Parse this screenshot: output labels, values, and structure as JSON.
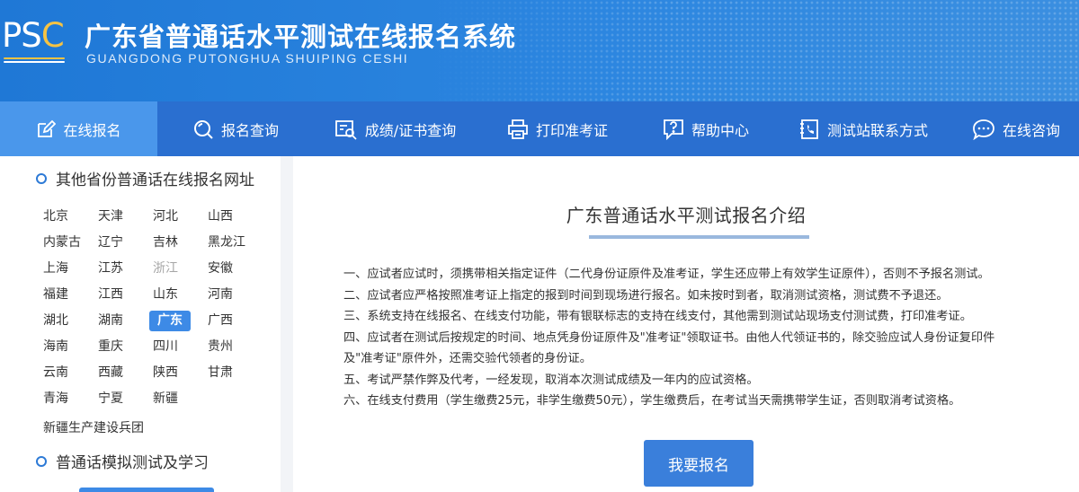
{
  "header": {
    "logo": "PSC",
    "title": "广东省普通话水平测试在线报名系统",
    "subtitle": "GUANGDONG PUTONGHUA SHUIPING CESHI"
  },
  "nav": {
    "items": [
      {
        "label": "在线报名",
        "icon": "edit-icon",
        "active": true
      },
      {
        "label": "报名查询",
        "icon": "search-icon"
      },
      {
        "label": "成绩/证书查询",
        "icon": "certificate-search-icon"
      },
      {
        "label": "打印准考证",
        "icon": "printer-icon"
      },
      {
        "label": "帮助中心",
        "icon": "help-icon"
      },
      {
        "label": "测试站联系方式",
        "icon": "phone-book-icon"
      },
      {
        "label": "在线咨询",
        "icon": "chat-icon"
      }
    ]
  },
  "sidebar": {
    "heading_provinces": "其他省份普通话在线报名网址",
    "provinces": [
      "北京",
      "天津",
      "河北",
      "山西",
      "内蒙古",
      "辽宁",
      "吉林",
      "黑龙江",
      "上海",
      "江苏",
      "浙江",
      "安徽",
      "福建",
      "江西",
      "山东",
      "河南",
      "湖北",
      "湖南",
      "广东",
      "广西",
      "海南",
      "重庆",
      "四川",
      "贵州",
      "云南",
      "西藏",
      "陕西",
      "甘肃",
      "青海",
      "宁夏",
      "新疆"
    ],
    "active_province": "广东",
    "disabled_province": "浙江",
    "bingtuan": "新疆生产建设兵团",
    "heading_practice": "普通话模拟测试及学习"
  },
  "main": {
    "title": "广东普通话水平测试报名介绍",
    "rules": [
      "一、应试者应试时，须携带相关指定证件（二代身份证原件及准考证，学生还应带上有效学生证原件），否则不予报名测试。",
      "二、应试者应严格按照准考证上指定的报到时间到现场进行报名。如未按时到者，取消测试资格，测试费不予退还。",
      "三、系统支持在线报名、在线支付功能，带有银联标志的支持在线支付，其他需到测试站现场支付测试费，打印准考证。",
      "四、应试者在测试后按规定的时间、地点凭身份证原件及\"准考证\"领取证书。由他人代领证书的，除交验应试人身份证复印件",
      "及\"准考证\"原件外，还需交验代领者的身份证。",
      "五、考试严禁作弊及代考，一经发现，取消本次测试成绩及一年内的应试资格。",
      "六、在线支付费用（学生缴费25元，非学生缴费50元），学生缴费后，在考试当天需携带学生证，否则取消考试资格。"
    ],
    "register_button": "我要报名"
  },
  "colors": {
    "header_blue": "#1f78d6",
    "nav_blue": "#2a6fd0",
    "nav_active": "#4a97eb",
    "button_blue": "#3a7fdb",
    "logo_accent": "#f6c343"
  }
}
